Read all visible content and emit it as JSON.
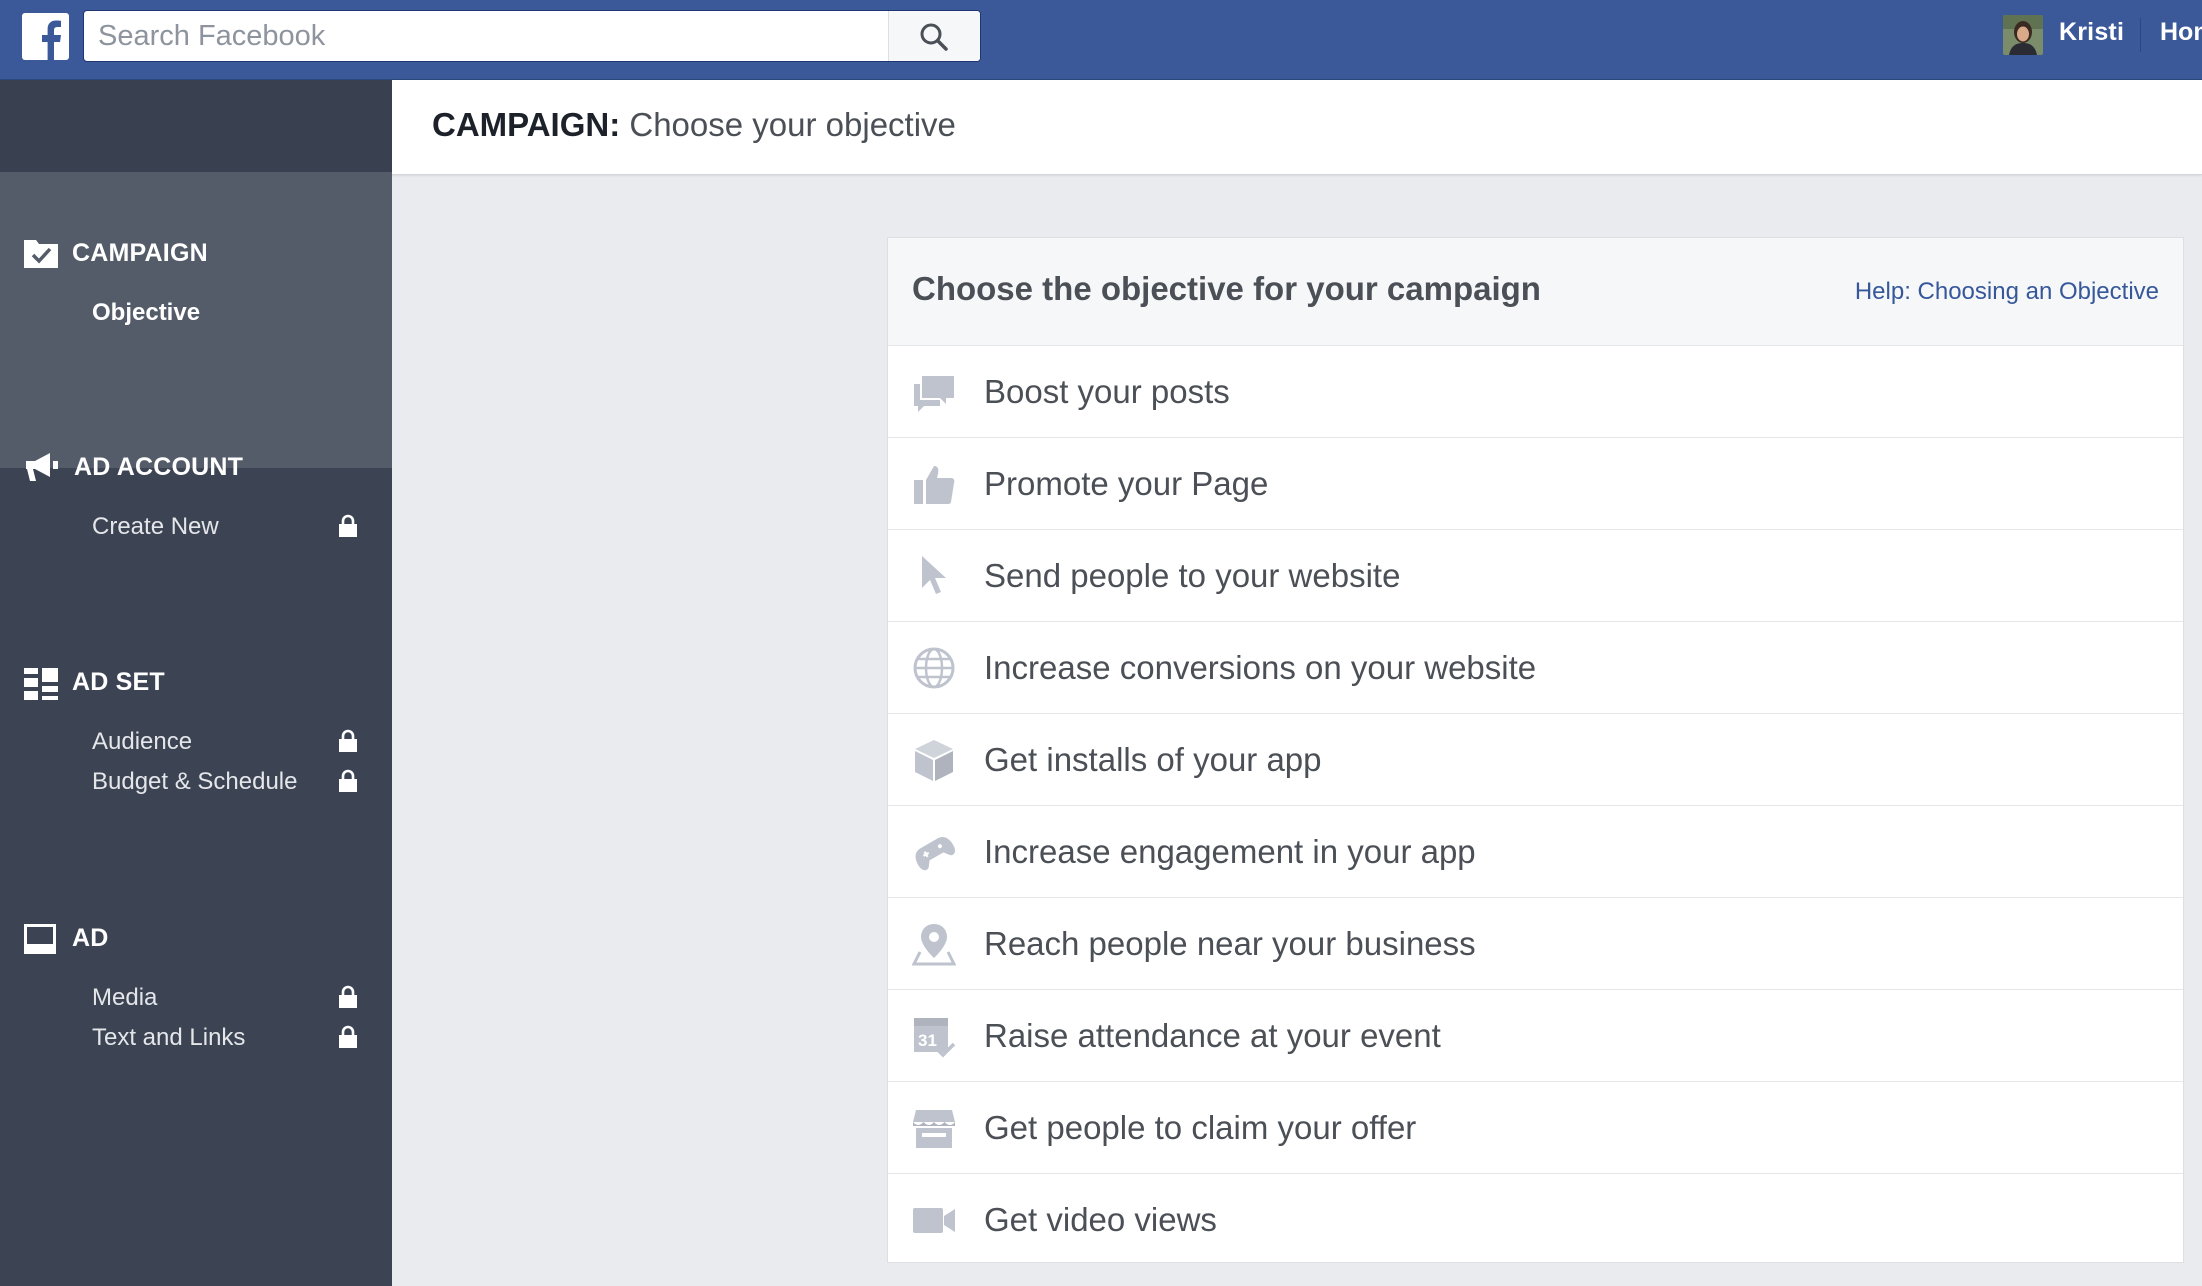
{
  "topbar": {
    "logo": "facebook-logo",
    "search_placeholder": "Search Facebook",
    "user_name": "Kristi",
    "home_link": "Home"
  },
  "sidebar": {
    "sections": [
      {
        "title": "CAMPAIGN",
        "icon": "checkmark-folder-icon",
        "items": [
          {
            "label": "Objective",
            "active": true,
            "locked": false
          }
        ]
      },
      {
        "title": "AD ACCOUNT",
        "icon": "megaphone-icon",
        "items": [
          {
            "label": "Create New",
            "locked": true
          }
        ]
      },
      {
        "title": "AD SET",
        "icon": "grid-icon",
        "items": [
          {
            "label": "Audience",
            "locked": true
          },
          {
            "label": "Budget & Schedule",
            "locked": true
          }
        ]
      },
      {
        "title": "AD",
        "icon": "monitor-icon",
        "items": [
          {
            "label": "Media",
            "locked": true
          },
          {
            "label": "Text and Links",
            "locked": true
          }
        ]
      }
    ]
  },
  "header": {
    "title_prefix": "CAMPAIGN:",
    "title_text": "Choose your objective"
  },
  "objective_card": {
    "title": "Choose the objective for your campaign",
    "help_link": "Help: Choosing an Objective",
    "objectives": [
      {
        "label": "Boost your posts",
        "icon": "speech-bubbles-icon"
      },
      {
        "label": "Promote your Page",
        "icon": "thumbs-up-icon"
      },
      {
        "label": "Send people to your website",
        "icon": "cursor-icon"
      },
      {
        "label": "Increase conversions on your website",
        "icon": "globe-icon"
      },
      {
        "label": "Get installs of your app",
        "icon": "box-icon"
      },
      {
        "label": "Increase engagement in your app",
        "icon": "gamepad-icon"
      },
      {
        "label": "Reach people near your business",
        "icon": "map-pin-icon"
      },
      {
        "label": "Raise attendance at your event",
        "icon": "calendar-icon"
      },
      {
        "label": "Get people to claim your offer",
        "icon": "storefront-icon"
      },
      {
        "label": "Get video views",
        "icon": "video-camera-icon"
      }
    ]
  },
  "colors": {
    "topbar": "#3b5998",
    "sidebar": "#3c4453",
    "sidebar_active": "#555c69",
    "link": "#365899",
    "icon": "#bec3cd"
  }
}
